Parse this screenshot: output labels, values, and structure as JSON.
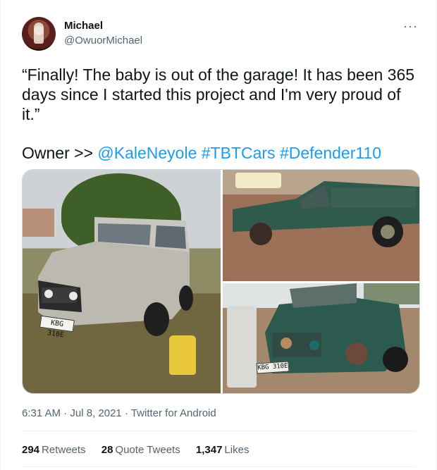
{
  "author": {
    "name": "Michael",
    "handle": "@OwuorMichael"
  },
  "more_menu_icon": "ellipsis-icon",
  "tweet": {
    "text": "“Finally! The baby is out of the garage! It has been 365 days since I started this project and I'm very proud of it.”",
    "owner_prefix": "Owner >> ",
    "mention": "@KaleNeyole",
    "hashtag1": "#TBTCars",
    "hashtag2": "#Defender110"
  },
  "media": {
    "photo1_plate": "KBG 310E",
    "photo3_plate": "KBG 310E"
  },
  "meta": {
    "time": "6:31 AM",
    "separator": " · ",
    "date": "Jul 8, 2021",
    "source": "Twitter for Android"
  },
  "stats": {
    "retweets_count": "294",
    "retweets_label": "Retweets",
    "quotes_count": "28",
    "quotes_label": "Quote Tweets",
    "likes_count": "1,347",
    "likes_label": "Likes"
  },
  "colors": {
    "link": "#1d9bf0",
    "secondary_text": "#536471",
    "primary_text": "#0f1419"
  }
}
